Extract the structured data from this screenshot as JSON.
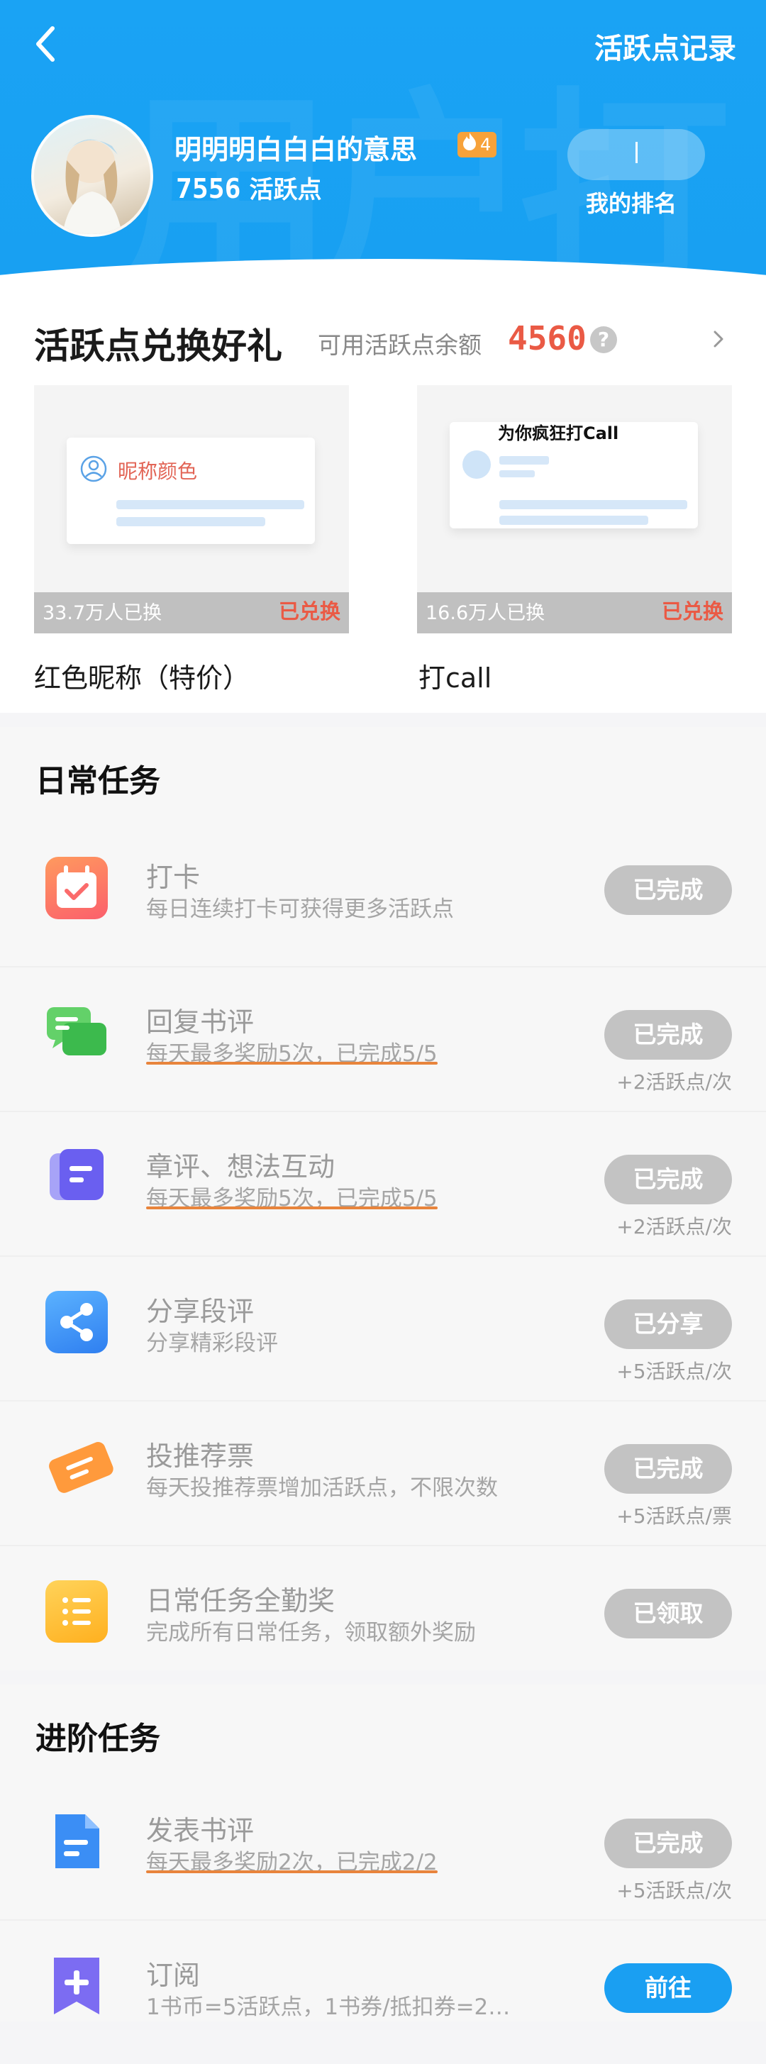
{
  "header": {
    "records_link": "活跃点记录",
    "watermark": "用户打",
    "user_name": "明明明白白白的意思",
    "level": "4",
    "points_value": "7556",
    "points_unit": "活跃点",
    "rank_label": "我的排名"
  },
  "exchange": {
    "title": "活跃点兑换好礼",
    "balance_label": "可用活跃点余额",
    "balance_value": "4560",
    "help": "?",
    "cards": [
      {
        "name": "红色昵称（特价）",
        "sold": "33.7万人已换",
        "status": "已兑换",
        "preview_label": "昵称颜色"
      },
      {
        "name": "打call",
        "sold": "16.6万人已换",
        "status": "已兑换",
        "preview_label": "为你疯狂打Call"
      }
    ]
  },
  "daily": {
    "title": "日常任务",
    "tasks": [
      {
        "name": "打卡",
        "desc": "每日连续打卡可获得更多活跃点",
        "button": "已完成",
        "reward": ""
      },
      {
        "name": "回复书评",
        "desc": "每天最多奖励5次，已完成5/5",
        "button": "已完成",
        "reward": "+2活跃点/次"
      },
      {
        "name": "章评、想法互动",
        "desc": "每天最多奖励5次，已完成5/5",
        "button": "已完成",
        "reward": "+2活跃点/次"
      },
      {
        "name": "分享段评",
        "desc": "分享精彩段评",
        "button": "已分享",
        "reward": "+5活跃点/次"
      },
      {
        "name": "投推荐票",
        "desc": "每天投推荐票增加活跃点，不限次数",
        "button": "已完成",
        "reward": "+5活跃点/票"
      },
      {
        "name": "日常任务全勤奖",
        "desc": "完成所有日常任务，领取额外奖励",
        "button": "已领取",
        "reward": ""
      }
    ]
  },
  "advanced": {
    "title": "进阶任务",
    "tasks": [
      {
        "name": "发表书评",
        "desc": "每天最多奖励2次，已完成2/2",
        "button": "已完成",
        "reward": "+5活跃点/次"
      },
      {
        "name": "订阅",
        "desc": "1书币=5活跃点，1书券/抵扣券=2…",
        "button": "前往",
        "reward": ""
      }
    ]
  },
  "colors": {
    "header_blue": "#18a0f2",
    "accent_red": "#ea5a45",
    "underline_orange": "#e8843c",
    "button_gray": "#c3c3c3",
    "button_blue": "#1a9ff2"
  }
}
